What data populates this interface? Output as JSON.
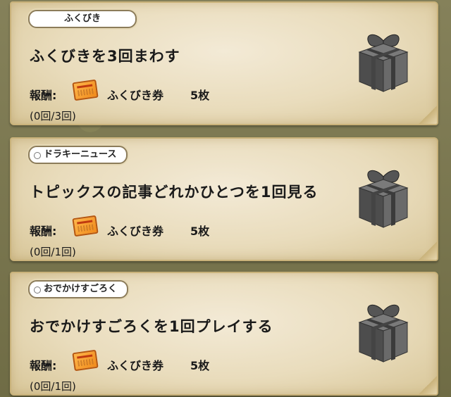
{
  "missions": [
    {
      "category": "ふくびき",
      "title": "ふくびきを3回まわす",
      "reward_label": "報酬:",
      "reward_item": "ふくびき券",
      "reward_quantity": "5枚",
      "progress": "(0回/3回)",
      "reward_icon": "ticket-icon",
      "status_icon": "gift-box-icon"
    },
    {
      "category": "ドラキーニュース",
      "title": "トピックスの記事どれかひとつを1回見る",
      "reward_label": "報酬:",
      "reward_item": "ふくびき券",
      "reward_quantity": "5枚",
      "progress": "(0回/1回)",
      "reward_icon": "ticket-icon",
      "status_icon": "gift-box-icon"
    },
    {
      "category": "おでかけすごろく",
      "title": "おでかけすごろくを1回プレイする",
      "reward_label": "報酬:",
      "reward_item": "ふくびき券",
      "reward_quantity": "5枚",
      "progress": "(0回/1回)",
      "reward_icon": "ticket-icon",
      "status_icon": "gift-box-icon"
    }
  ],
  "colors": {
    "background": "#7d7a4e",
    "card": "#e9dcbc",
    "ticket": "#f08a1a",
    "gift": "#5a5a5a"
  }
}
